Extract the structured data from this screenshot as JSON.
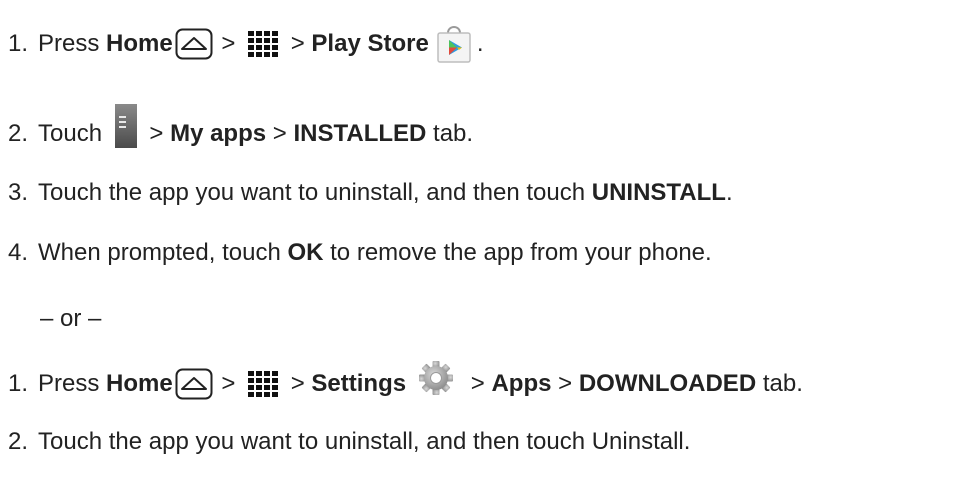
{
  "section_a": {
    "step1": {
      "num": "1.",
      "t1": "Press ",
      "home": "Home",
      "gt1": " > ",
      "gt2": " > ",
      "store": "Play Store",
      "end": "."
    },
    "step2": {
      "num": "2.",
      "t1": "Touch ",
      "gt1": " > ",
      "myapps": "My apps",
      "gt2": " > ",
      "installed": "INSTALLED",
      "end": " tab."
    },
    "step3": {
      "num": "3.",
      "t1": "Touch the app you want to uninstall, and then touch ",
      "uninstall": "UNINSTALL",
      "end": "."
    },
    "step4": {
      "num": "4.",
      "t1": "When prompted, touch ",
      "ok": "OK",
      "end": " to remove the app from your phone."
    }
  },
  "or_text": "– or –",
  "section_b": {
    "step1": {
      "num": "1.",
      "t1": "Press ",
      "home": "Home",
      "gt1": " > ",
      "gt2": " > ",
      "settings": "Settings",
      "gt3": " > ",
      "apps": "Apps",
      "gt4": " > ",
      "downloaded": "DOWNLOADED",
      "end": " tab."
    },
    "step2": {
      "num": "2.",
      "t1": "Touch the app you want to uninstall, and then touch Uninstall."
    }
  },
  "icons": {
    "home": "home-icon",
    "apps_grid": "apps-grid-icon",
    "play_store": "play-store-icon",
    "menu": "menu-icon",
    "settings": "gear-icon"
  }
}
